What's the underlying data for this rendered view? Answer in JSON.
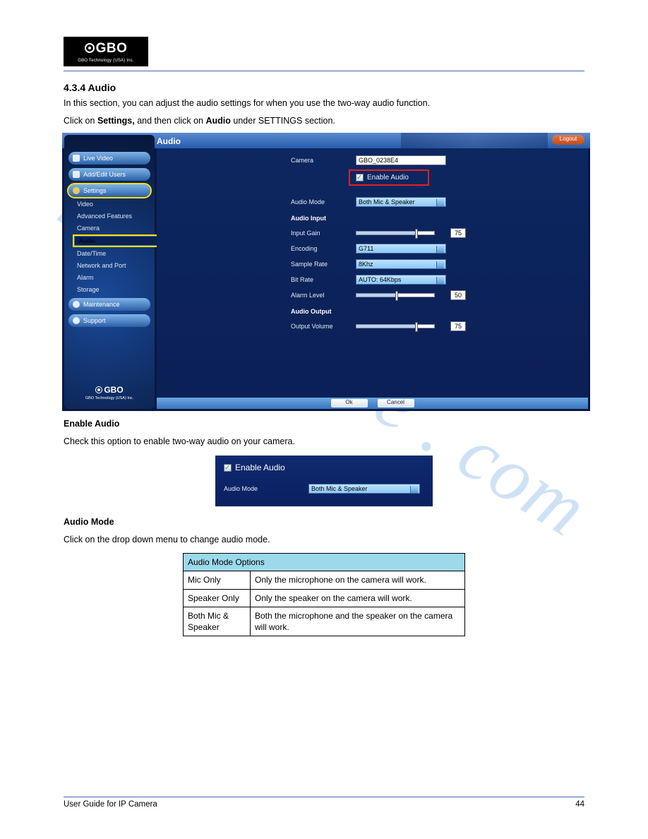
{
  "doc": {
    "logo_main": "GBO",
    "logo_sub": "GBO Technology (USA) Inc.",
    "title_number": "4.3.4 Audio",
    "intro1": "In this section, you can adjust the audio settings for when you use the two-way audio function.",
    "intro2_a": "Click on ",
    "intro2_b": "Settings, ",
    "intro2_c": "and then click on ",
    "intro2_d": "Audio ",
    "intro2_e": "under SETTINGS section.",
    "enable_hdr": "Enable Audio",
    "enable_txt": "Check this option to enable two-way audio on your camera.",
    "mode_hdr": "Audio Mode",
    "mode_txt": "Click on the drop down menu to change audio mode.",
    "table_header": "Audio Mode Options",
    "table": [
      {
        "c": "Mic Only",
        "d": "Only the microphone on the camera will work."
      },
      {
        "c": "Speaker Only",
        "d": "Only the speaker on the camera will work."
      },
      {
        "c": "Both Mic & Speaker",
        "d": "Both the microphone and the speaker on the camera will work."
      }
    ],
    "footer_left": "User Guide for IP Camera",
    "footer_right": "44"
  },
  "ss": {
    "title": "Audio",
    "logout": "Logout",
    "nav": {
      "live": "Live Video",
      "users": "Add/Edit Users",
      "settings": "Settings",
      "maint": "Maintenance",
      "support": "Support"
    },
    "sub": {
      "video": "Video",
      "adv": "Advanced Features",
      "camera": "Camera",
      "audio": "Audio",
      "datetime": "Date/Time",
      "net": "Network and Port",
      "alarm": "Alarm",
      "storage": "Storage"
    },
    "logo_main": "GBO",
    "logo_sub": "GBO Technology (USA) Inc.",
    "form": {
      "camera_l": "Camera",
      "camera_v": "GBO_0238E4",
      "enable": "Enable Audio",
      "mode_l": "Audio Mode",
      "mode_v": "Both Mic & Speaker",
      "input_hdr": "Audio Input",
      "gain_l": "Input Gain",
      "gain_v": "75",
      "enc_l": "Encoding",
      "enc_v": "G711",
      "rate_l": "Sample Rate",
      "rate_v": "8Khz",
      "bitrate_l": "Bit Rate",
      "bitrate_v": "AUTO: 64Kbps",
      "alarm_l": "Alarm Level",
      "alarm_v": "50",
      "output_hdr": "Audio Output",
      "outvol_l": "Output Volume",
      "outvol_v": "75",
      "ok": "Ok",
      "cancel": "Cancel"
    }
  },
  "panel": {
    "enable": "Enable Audio",
    "mode_l": "Audio Mode",
    "mode_v": "Both Mic & Speaker"
  }
}
